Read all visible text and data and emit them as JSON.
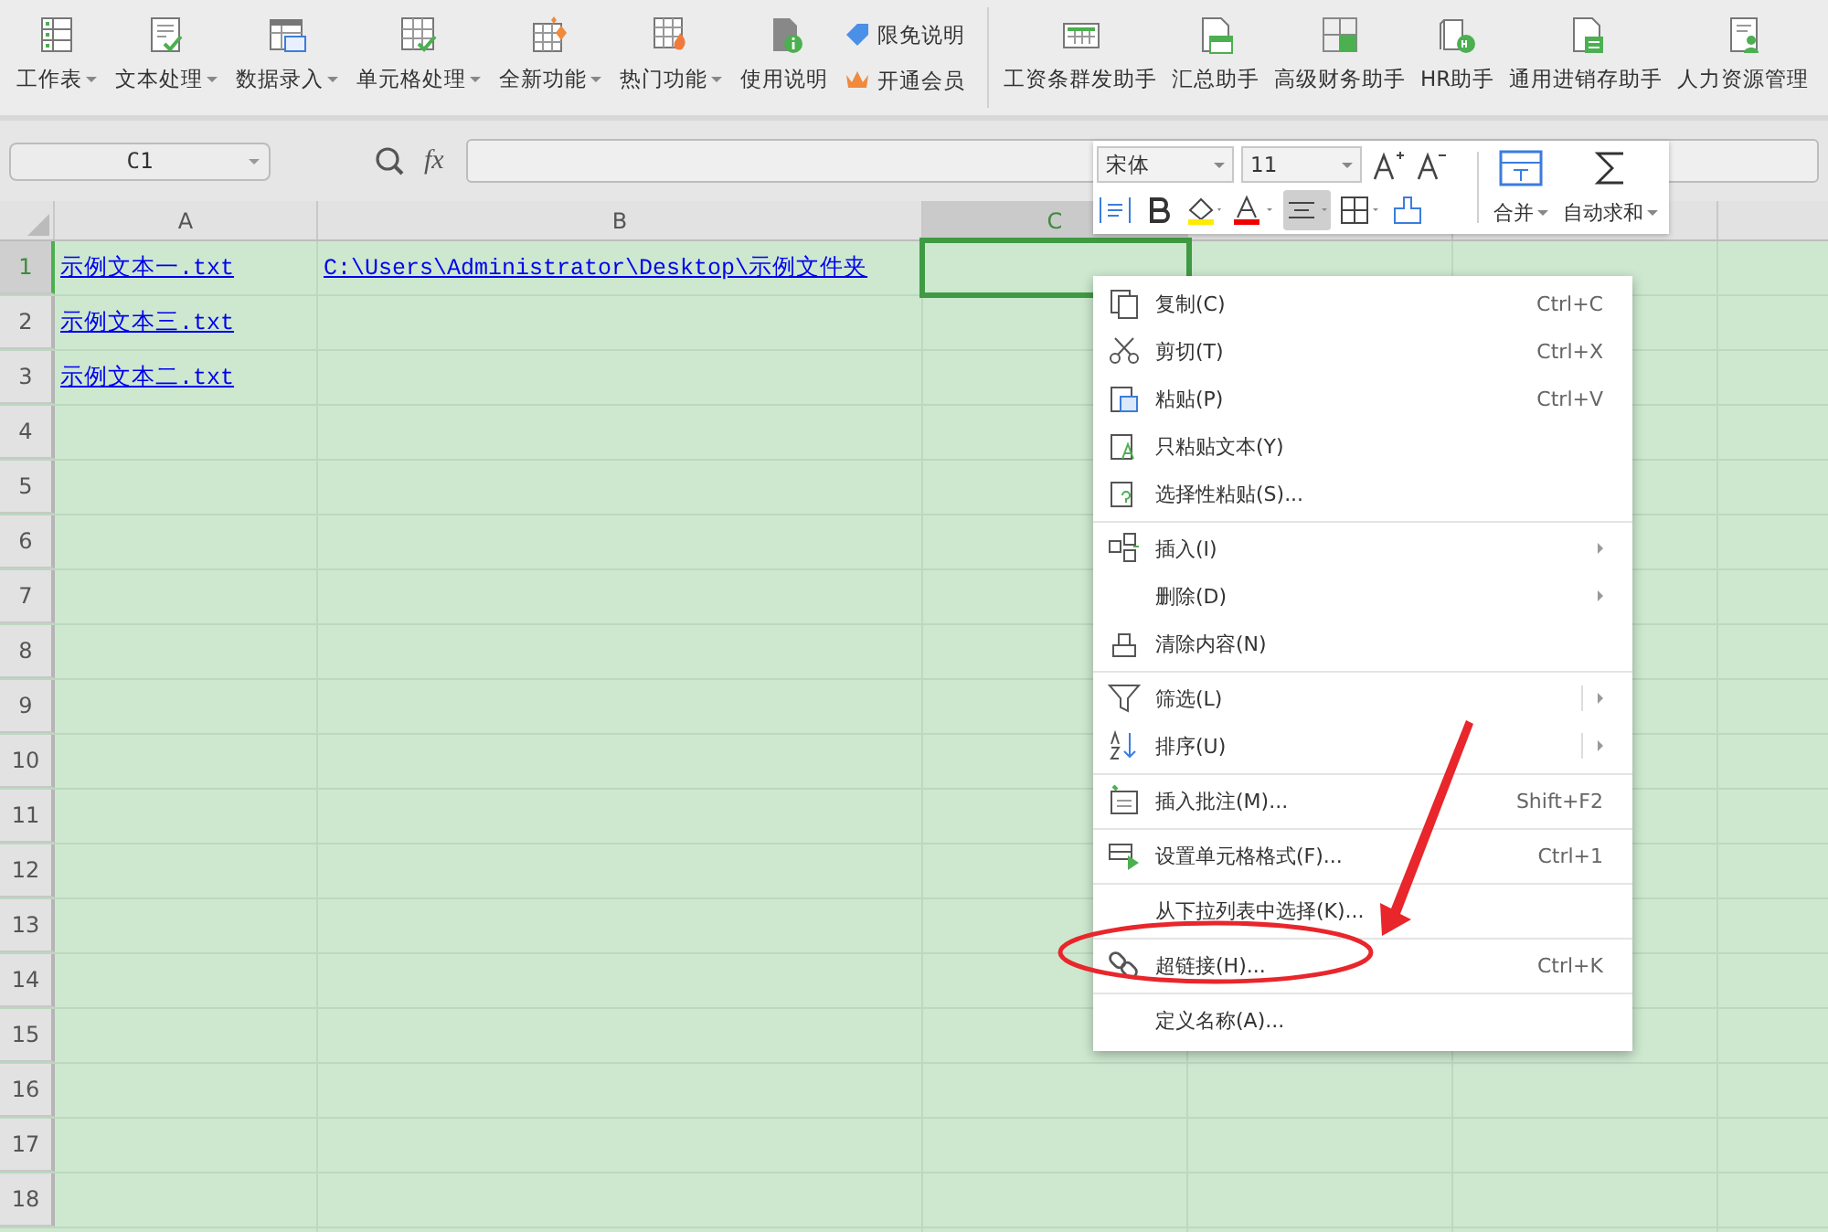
{
  "ribbon": {
    "tools": [
      {
        "label": "工作表",
        "dropdown": true
      },
      {
        "label": "文本处理",
        "dropdown": true
      },
      {
        "label": "数据录入",
        "dropdown": true
      },
      {
        "label": "单元格处理",
        "dropdown": true
      },
      {
        "label": "全新功能",
        "dropdown": true
      },
      {
        "label": "热门功能",
        "dropdown": true
      },
      {
        "label": "使用说明",
        "dropdown": false
      }
    ],
    "links": [
      "限免说明",
      "开通会员"
    ],
    "helpers": [
      "工资条群发助手",
      "汇总助手",
      "高级财务助手",
      "HR助手",
      "通用进销存助手",
      "人力资源管理"
    ]
  },
  "formula_bar": {
    "cell_ref": "C1",
    "function_label": "fx"
  },
  "columns": [
    {
      "label": "A",
      "selected": false
    },
    {
      "label": "B",
      "selected": false
    },
    {
      "label": "C",
      "selected": true
    }
  ],
  "rows": [
    {
      "number": "1",
      "selected": true,
      "cells": [
        "示例文本一.txt",
        "C:\\Users\\Administrator\\Desktop\\示例文件夹"
      ]
    },
    {
      "number": "2",
      "selected": false,
      "cells": [
        "示例文本三.txt"
      ]
    },
    {
      "number": "3",
      "selected": false,
      "cells": [
        "示例文本二.txt"
      ]
    },
    {
      "number": "4",
      "selected": false
    },
    {
      "number": "5",
      "selected": false
    },
    {
      "number": "6",
      "selected": false
    },
    {
      "number": "7",
      "selected": false
    },
    {
      "number": "8",
      "selected": false
    },
    {
      "number": "9",
      "selected": false
    },
    {
      "number": "10",
      "selected": false
    },
    {
      "number": "11",
      "selected": false
    },
    {
      "number": "12",
      "selected": false
    },
    {
      "number": "13",
      "selected": false
    },
    {
      "number": "14",
      "selected": false
    },
    {
      "number": "15",
      "selected": false
    },
    {
      "number": "16",
      "selected": false
    },
    {
      "number": "17",
      "selected": false
    },
    {
      "number": "18",
      "selected": false
    }
  ],
  "mini_toolbar": {
    "font": "宋体",
    "size": "11",
    "align_pressed": true,
    "merge": "合并",
    "autosum": "自动求和"
  },
  "context_menu": {
    "items": [
      {
        "label": "复制(C)",
        "shortcut": "Ctrl+C",
        "submenu": false,
        "split_submenu": false,
        "separator_before": false
      },
      {
        "label": "剪切(T)",
        "shortcut": "Ctrl+X",
        "submenu": false,
        "split_submenu": false,
        "separator_before": false
      },
      {
        "label": "粘贴(P)",
        "shortcut": "Ctrl+V",
        "submenu": false,
        "split_submenu": false,
        "separator_before": false
      },
      {
        "label": "只粘贴文本(Y)",
        "submenu": false,
        "split_submenu": false,
        "separator_before": false
      },
      {
        "label": "选择性粘贴(S)...",
        "submenu": false,
        "split_submenu": false,
        "separator_before": false
      },
      {
        "label": "插入(I)",
        "submenu": true,
        "split_submenu": false,
        "separator_before": true
      },
      {
        "label": "删除(D)",
        "submenu": true,
        "split_submenu": false,
        "separator_before": false
      },
      {
        "label": "清除内容(N)",
        "submenu": false,
        "split_submenu": false,
        "separator_before": false
      },
      {
        "label": "筛选(L)",
        "submenu": true,
        "split_submenu": true,
        "separator_before": true
      },
      {
        "label": "排序(U)",
        "submenu": true,
        "split_submenu": true,
        "separator_before": false
      },
      {
        "label": "插入批注(M)...",
        "shortcut": "Shift+F2",
        "submenu": false,
        "split_submenu": false,
        "separator_before": true
      },
      {
        "label": "设置单元格格式(F)...",
        "shortcut": "Ctrl+1",
        "submenu": false,
        "split_submenu": false,
        "separator_before": true
      },
      {
        "label": "从下拉列表中选择(K)...",
        "submenu": false,
        "split_submenu": false,
        "separator_before": true
      },
      {
        "label": "超链接(H)...",
        "shortcut": "Ctrl+K",
        "submenu": false,
        "split_submenu": false,
        "separator_before": true
      },
      {
        "label": "定义名称(A)...",
        "submenu": false,
        "split_submenu": false,
        "separator_before": true
      }
    ]
  }
}
